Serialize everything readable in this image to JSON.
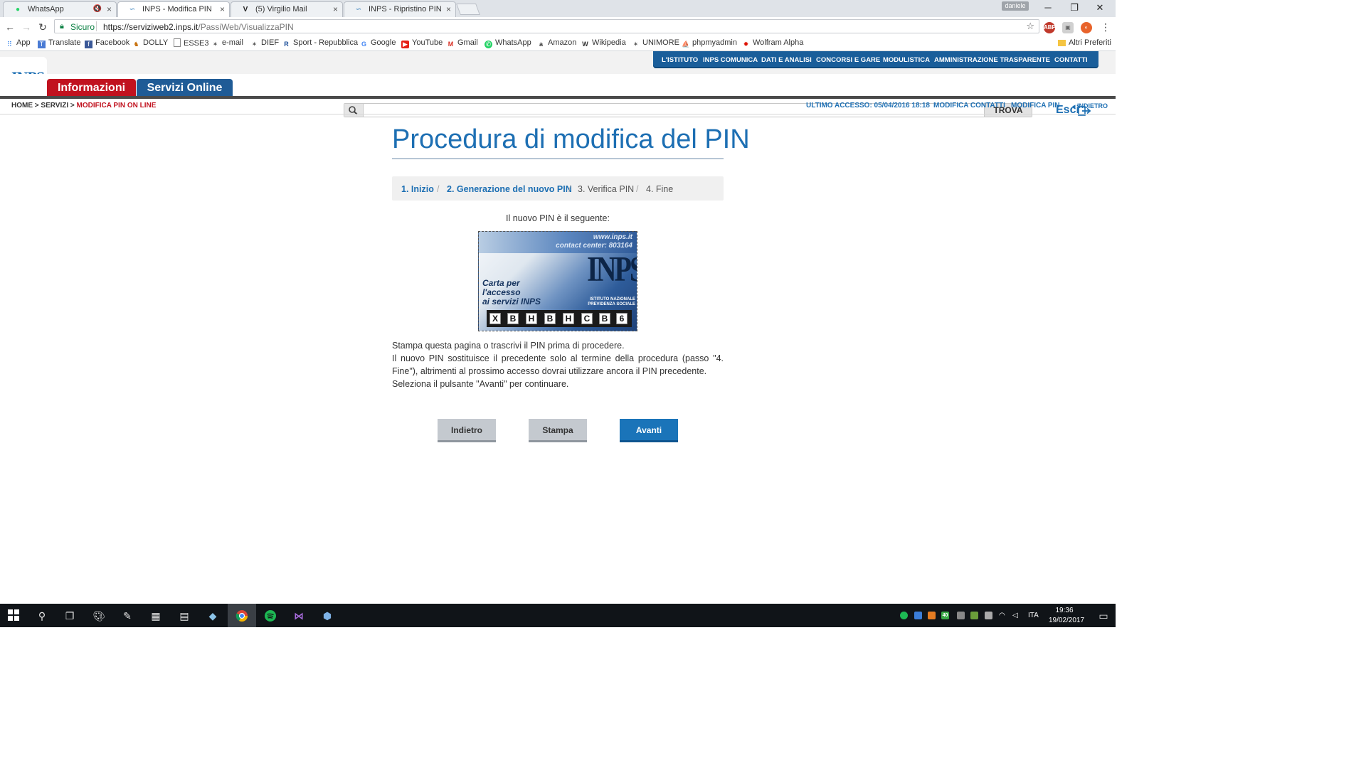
{
  "browser": {
    "tabs": [
      {
        "title": "WhatsApp",
        "icon": "whatsapp-icon"
      },
      {
        "title": "INPS - Modifica PIN",
        "icon": "inps-icon",
        "active": true
      },
      {
        "title": "(5) Virgilio Mail",
        "icon": "virgilio-icon"
      },
      {
        "title": "INPS - Ripristino PIN",
        "icon": "inps-icon"
      }
    ],
    "user_badge": "daniele",
    "address": {
      "secure_label": "Sicuro",
      "host": "https://serviziweb2.inps.it",
      "path": "/PassiWeb/VisualizzaPIN"
    },
    "bookmarks": [
      "App",
      "Translate",
      "Facebook",
      "DOLLY",
      "ESSE3",
      "e-mail",
      "DIEF",
      "Sport - Repubblica",
      "Google",
      "YouTube",
      "Gmail",
      "WhatsApp",
      "Amazon",
      "Wikipedia",
      "UNIMORE",
      "phpmyadmin",
      "Wolfram Alpha"
    ],
    "other_bookmarks": "Altri Preferiti"
  },
  "inps": {
    "logo_text": "INPS",
    "topnav": [
      "L'ISTITUTO",
      "INPS COMUNICA",
      "DATI E ANALISI",
      "CONCORSI E GARE",
      "MODULISTICA",
      "AMMINISTRAZIONE TRASPARENTE",
      "CONTATTI"
    ],
    "tabs": {
      "info": "Informazioni",
      "services": "Servizi Online"
    },
    "search": {
      "placeholder": "",
      "button": "TROVA"
    },
    "logout": "Esci",
    "breadcrumb": {
      "home": "HOME",
      "services": "SERVIZI",
      "current": "MODIFICA PIN ON LINE"
    },
    "last_access": "ULTIMO ACCESSO: 05/04/2016 18:18",
    "modify_contacts": "MODIFICA CONTATTI",
    "modify_pin": "MODIFICA PIN",
    "back_link": "INDIETRO"
  },
  "main": {
    "title": "Procedura di modifica del PIN",
    "steps": [
      {
        "label": "1. Inizio",
        "done": true
      },
      {
        "label": "2. Generazione del nuovo PIN",
        "done": true
      },
      {
        "label": "3. Verifica PIN",
        "done": false
      },
      {
        "label": "4. Fine",
        "done": false
      }
    ],
    "pin_label": "Il nuovo PIN è il seguente:",
    "card": {
      "website": "www.inps.it",
      "contact": "contact center: 803164",
      "caption_line1": "Carta per",
      "caption_line2": "l'accesso",
      "caption_line3": "ai servizi INPS",
      "brand": "INPS",
      "institute_line1": "ISTITUTO NAZIONALE",
      "institute_line2": "PREVIDENZA SOCIALE",
      "pin": [
        "X",
        "B",
        "H",
        "B",
        "H",
        "C",
        "B",
        "6"
      ]
    },
    "message": [
      "Stampa questa pagina o trascrivi il PIN prima di procedere.",
      "Il nuovo PIN sostituisce il precedente solo al termine della procedura (passo \"4. Fine\"), altrimenti al prossimo accesso dovrai utilizzare ancora il PIN precedente.",
      "Seleziona il pulsante \"Avanti\" per continuare."
    ],
    "buttons": {
      "back": "Indietro",
      "print": "Stampa",
      "next": "Avanti"
    }
  },
  "taskbar": {
    "language": "ITA",
    "time": "19:36",
    "date": "19/02/2017"
  },
  "colors": {
    "inps_blue": "#1d6fb3",
    "inps_red": "#c1121f",
    "button_blue": "#1a74b9",
    "button_gray": "#c4c9cf"
  }
}
